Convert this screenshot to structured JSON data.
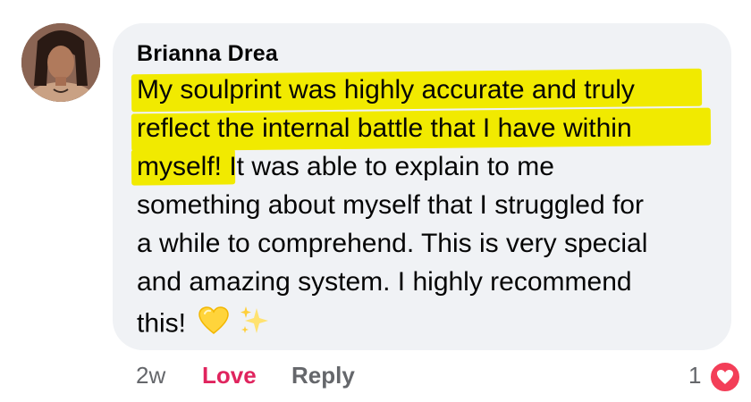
{
  "comment": {
    "author": "Brianna Drea",
    "lines": [
      "My soulprint was highly accurate and truly",
      "reflect the internal battle that I have within",
      "myself! It was able to explain to me",
      "something about myself that I struggled for",
      "a while to comprehend. This is very special",
      "and amazing system. I highly recommend",
      "this!"
    ],
    "emojis": [
      "yellow-heart-icon",
      "sparkles-icon"
    ]
  },
  "actions": {
    "time": "2w",
    "love_label": "Love",
    "reply_label": "Reply",
    "reaction_count": "1",
    "reaction_icon": "heart-icon"
  },
  "colors": {
    "bubble": "#f0f2f5",
    "highlight": "#f1ea00",
    "love": "#e0245e",
    "reaction_badge": "#f33e58",
    "muted": "#65676b"
  }
}
